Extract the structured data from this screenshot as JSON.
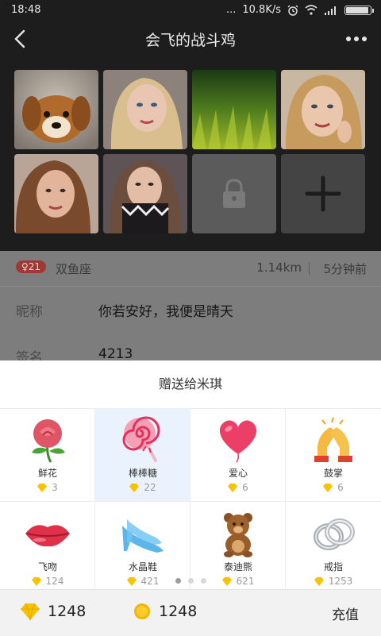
{
  "status_bar": {
    "time": "18:48",
    "network_speed": "10.8K/s",
    "dots": "..."
  },
  "header": {
    "title": "会飞的战斗鸡",
    "back_icon": "chevron-left-icon",
    "more_icon": "more-dots-icon"
  },
  "photos": [
    {
      "name": "photo-puppy",
      "kind": "photo"
    },
    {
      "name": "photo-woman-1",
      "kind": "photo"
    },
    {
      "name": "photo-grass",
      "kind": "photo"
    },
    {
      "name": "photo-woman-2",
      "kind": "photo"
    },
    {
      "name": "photo-woman-3",
      "kind": "photo"
    },
    {
      "name": "photo-woman-4",
      "kind": "photo"
    },
    {
      "name": "locked-photo",
      "kind": "locked"
    },
    {
      "name": "add-photo-button",
      "kind": "add"
    }
  ],
  "profile": {
    "age_badge": "♀21",
    "zodiac": "双鱼座",
    "distance": "1.14km",
    "last_active": "5分钟前",
    "nickname_label": "昵称",
    "nickname_value": "你若安好，我便是晴天",
    "signature_label": "签名",
    "signature_value": "4213"
  },
  "gift_sheet": {
    "title": "赠送给米琪",
    "gifts": [
      {
        "name": "鲜花",
        "price": "3",
        "icon": "rose-icon",
        "selected": false
      },
      {
        "name": "棒棒糖",
        "price": "22",
        "icon": "lollipop-icon",
        "selected": true
      },
      {
        "name": "爱心",
        "price": "6",
        "icon": "heart-balloon-icon",
        "selected": false
      },
      {
        "name": "鼓掌",
        "price": "6",
        "icon": "clapping-hands-icon",
        "selected": false
      },
      {
        "name": "飞吻",
        "price": "124",
        "icon": "lips-icon",
        "selected": false
      },
      {
        "name": "水晶鞋",
        "price": "421",
        "icon": "crystal-shoe-icon",
        "selected": false
      },
      {
        "name": "泰迪熊",
        "price": "621",
        "icon": "teddy-bear-icon",
        "selected": false
      },
      {
        "name": "戒指",
        "price": "1253",
        "icon": "rings-icon",
        "selected": false
      }
    ],
    "pages": 3,
    "active_page": 0
  },
  "bottom_bar": {
    "diamonds": "1248",
    "coins": "1248",
    "recharge_label": "充值"
  },
  "colors": {
    "diamond": "#f7c200",
    "coin": "#f5b400",
    "selected_bg": "#eaf3fd",
    "age_badge": "#9e3a35"
  }
}
